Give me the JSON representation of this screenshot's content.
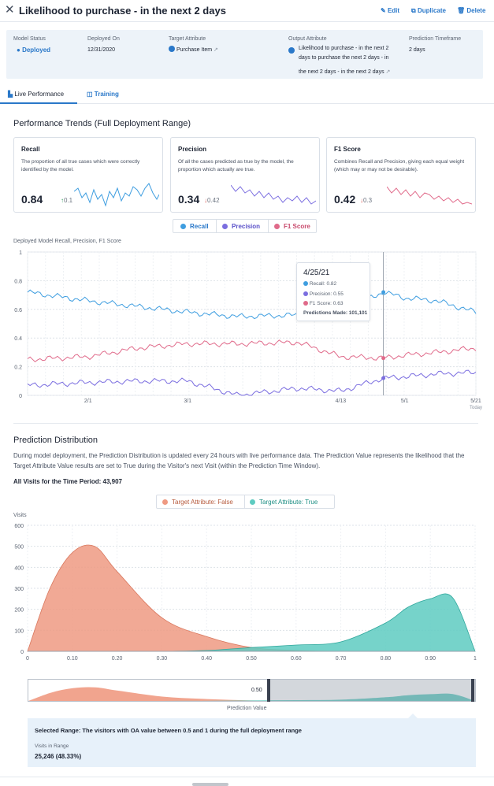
{
  "header": {
    "title": "Likelihood to purchase - in the next 2 days",
    "edit_label": "Edit",
    "duplicate_label": "Duplicate",
    "delete_label": "Delete"
  },
  "model_info": {
    "status_label": "Model Status",
    "status_value": "Deployed",
    "deployed_on_label": "Deployed On",
    "deployed_on_value": "12/31/2020",
    "target_label": "Target Attribute",
    "target_value": "Purchase Item",
    "output_label": "Output Attribute",
    "output_lines": [
      "Likelihood to purchase - in the next 2",
      "days to purchase the next 2 days  - in",
      "the next 2 days  - in the next 2 days"
    ],
    "timeframe_label": "Prediction Timeframe",
    "timeframe_value": "2 days"
  },
  "tabs": [
    {
      "label": "Live Performance"
    },
    {
      "label": "Training"
    }
  ],
  "performance": {
    "title": "Performance Trends (Full Deployment Range)",
    "cards": [
      {
        "title": "Recall",
        "description": "The proportion of all true cases which were correctly identified by the model.",
        "value": "0.84",
        "delta": "0.1",
        "delta_direction": "up",
        "color": "#3f9ee0"
      },
      {
        "title": "Precision",
        "description": "Of all the cases predicted as true by the model, the proportion which actually are true.",
        "value": "0.34",
        "delta": "0.42",
        "delta_direction": "down",
        "color": "#7b6ee0"
      },
      {
        "title": "F1 Score",
        "description": "Combines Recall and Precision, giving each equal weight (which may or may not be desirable).",
        "value": "0.42",
        "delta": "0.3",
        "delta_direction": "down",
        "color": "#e06a8a"
      }
    ],
    "legend": [
      "Recall",
      "Precision",
      "F1 Score"
    ],
    "series_colors": {
      "recall": "#3f9ee0",
      "precision": "#7b6ee0",
      "f1": "#e06a8a"
    }
  },
  "tooltip": {
    "date": "4/25/21",
    "recall": "Recall: 0.82",
    "precision": "Precision: 0.55",
    "f1": "F1 Score: 0.63",
    "predictions": "Predictions Made: 101,101"
  },
  "distribution": {
    "title": "Prediction Distribution",
    "description": "During model deployment, the Prediction Distribution is updated every 24 hours with live performance data. The Prediction Value represents the likelihood that the Target Attribute Value results are set to True during the Visitor's next Visit (within the Prediction Time Window).",
    "all_visits": "All Visits for the Time Period: 43,907",
    "legend": [
      "Target Attribute: False",
      "Target Attribute: True"
    ],
    "colors": {
      "false": "#ef9a82",
      "true": "#5ecbc1"
    },
    "range_value": "0.50",
    "selected_range_text": "Selected Range: The visitors with OA value between 0.5 and 1 during the full deployment range",
    "visits_in_range_label": "Visits in Range",
    "visits_in_range_value": "25,246 (48.33%)"
  },
  "chart_data": [
    {
      "type": "line",
      "title": "Deployed Model Recall, Precision, F1 Score",
      "x_ticks": [
        "2/1",
        "3/1",
        "4/13",
        "5/1",
        "5/21"
      ],
      "x_extra_label": "Today",
      "y_ticks": [
        "0",
        "0.2",
        "0.4",
        "0.6",
        "0.8",
        "1"
      ],
      "ylim": [
        0,
        1
      ],
      "grid": true,
      "x": [
        "1/15",
        "2/1",
        "2/15",
        "3/1",
        "3/15",
        "4/1",
        "4/13",
        "4/25",
        "5/1",
        "5/10",
        "5/21"
      ],
      "series": [
        {
          "name": "Recall",
          "values": [
            0.72,
            0.66,
            0.62,
            0.58,
            0.55,
            0.56,
            0.59,
            0.72,
            0.68,
            0.66,
            0.58
          ]
        },
        {
          "name": "Precision",
          "values": [
            0.07,
            0.09,
            0.1,
            0.1,
            0.0,
            0.05,
            0.03,
            0.12,
            0.13,
            0.15,
            0.16
          ]
        },
        {
          "name": "F1 Score",
          "values": [
            0.25,
            0.27,
            0.33,
            0.36,
            0.36,
            0.37,
            0.27,
            0.26,
            0.28,
            0.3,
            0.33
          ]
        }
      ]
    },
    {
      "type": "area",
      "ylabel": "Visits",
      "xlabel": "Prediction Value",
      "y_ticks": [
        "0",
        "100",
        "200",
        "300",
        "400",
        "500",
        "600"
      ],
      "ylim": [
        0,
        600
      ],
      "x_ticks": [
        "0",
        "0.10",
        "0.20",
        "0.30",
        "0.40",
        "0.50",
        "0.60",
        "0.70",
        "0.80",
        "0.90",
        "1"
      ],
      "x": [
        0,
        0.05,
        0.1,
        0.15,
        0.2,
        0.3,
        0.4,
        0.5,
        0.6,
        0.7,
        0.8,
        0.85,
        0.9,
        0.95,
        1.0
      ],
      "series": [
        {
          "name": "Target Attribute: False",
          "values": [
            0,
            300,
            470,
            500,
            380,
            160,
            70,
            18,
            4,
            0,
            0,
            0,
            0,
            0,
            0
          ]
        },
        {
          "name": "Target Attribute: True",
          "values": [
            0,
            0,
            0,
            0,
            0,
            0,
            4,
            18,
            30,
            45,
            135,
            210,
            250,
            255,
            0
          ]
        }
      ]
    }
  ]
}
